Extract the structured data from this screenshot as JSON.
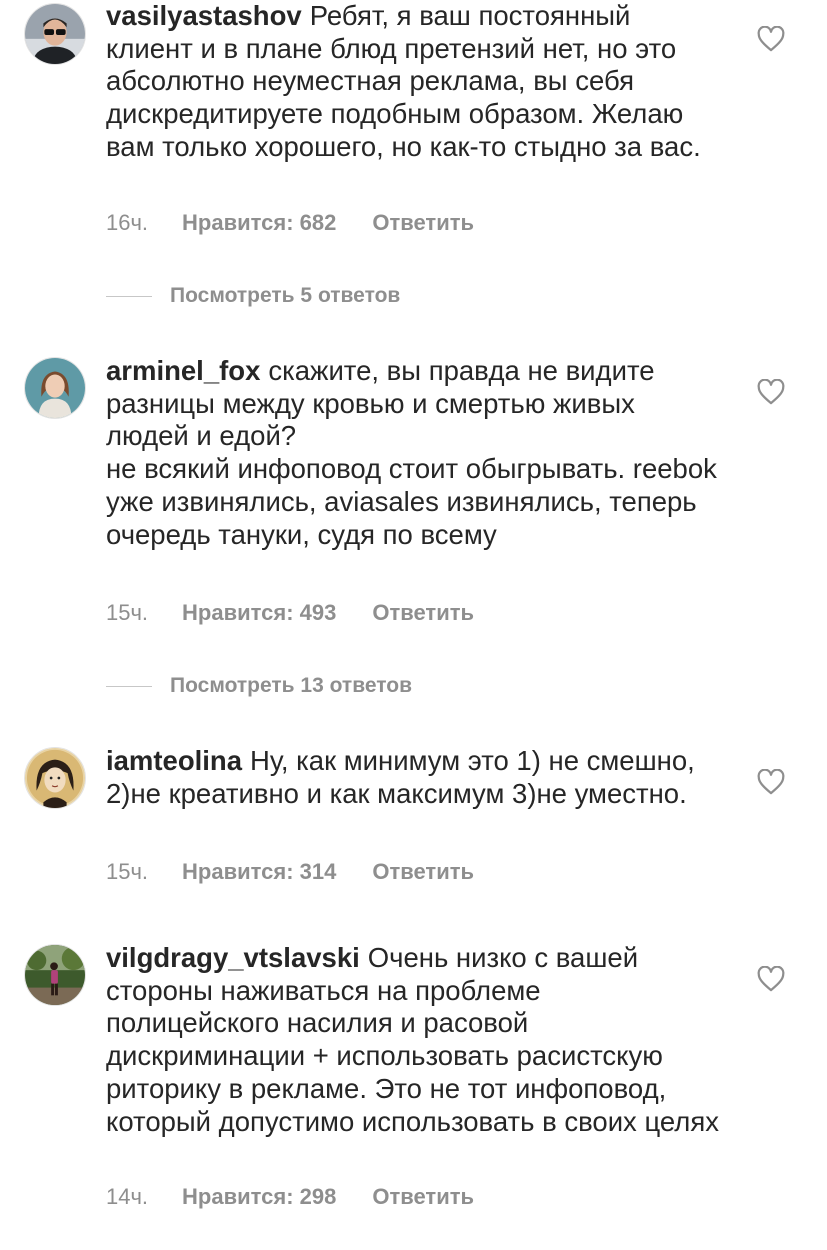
{
  "comments": [
    {
      "username": "vasilyastashov",
      "paragraphs": [
        "Ребят, я ваш постоянный клиент и в плане блюд претензий нет, но это абсолютно неуместная реклама, вы себя дискредитируете подобным образом. Желаю вам только хорошего, но как-то стыдно за вас."
      ],
      "time": "16ч.",
      "likes": "Нравится: 682",
      "reply": "Ответить",
      "view_replies": "Посмотреть 5 ответов",
      "avatar_icon": "man-sunglasses-avatar"
    },
    {
      "username": "arminel_fox",
      "paragraphs": [
        "скажите, вы правда не видите разницы между кровью и смертью живых людей и едой?",
        "не всякий инфоповод стоит обыгрывать. reebok уже извинялись, aviasales извинялись, теперь очередь тануки, судя по всему"
      ],
      "time": "15ч.",
      "likes": "Нравится: 493",
      "reply": "Ответить",
      "view_replies": "Посмотреть 13 ответов",
      "avatar_icon": "woman-portrait-avatar"
    },
    {
      "username": "iamteolina",
      "paragraphs": [
        "Ну, как минимум это 1) не смешно, 2)не креативно и как максимум 3)не уместно."
      ],
      "time": "15ч.",
      "likes": "Нравится: 314",
      "reply": "Ответить",
      "avatar_icon": "drawn-portrait-avatar"
    },
    {
      "username": "vilgdragy_vtslavski",
      "paragraphs": [
        "Очень низко с вашей стороны наживаться на проблеме полицейского насилия и расовой дискриминации + использовать расистскую риторику в рекламе. Это не тот инфоповод, который допустимо использовать в своих целях"
      ],
      "time": "14ч.",
      "likes": "Нравится: 298",
      "reply": "Ответить",
      "avatar_icon": "outdoor-photo-avatar"
    }
  ],
  "colors": {
    "text": "#262626",
    "secondary": "#8e8e8e",
    "divider": "#c7c7c7"
  }
}
